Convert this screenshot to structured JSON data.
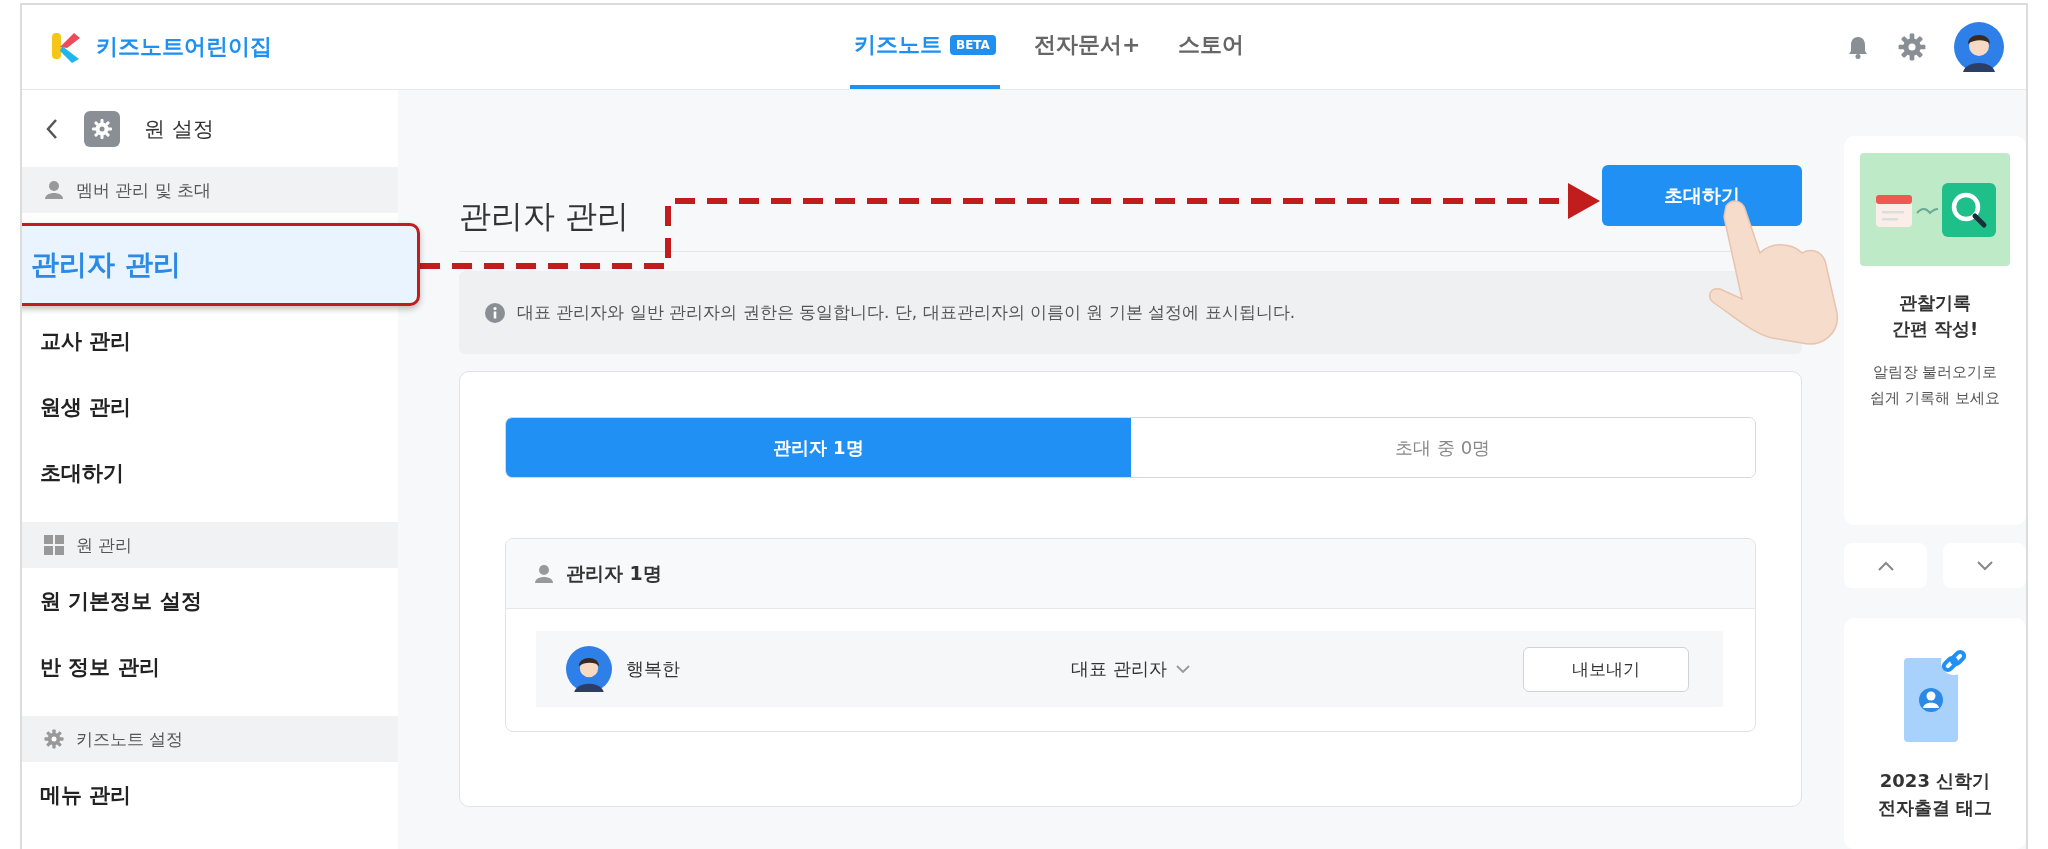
{
  "header": {
    "brand": "키즈노트어린이집",
    "nav": [
      {
        "label": "키즈노트",
        "badge": "BETA",
        "selected": true
      },
      {
        "label": "전자문서+",
        "selected": false
      },
      {
        "label": "스토어",
        "selected": false
      }
    ]
  },
  "sidebar": {
    "title": "원 설정",
    "sections": [
      {
        "kind": "person",
        "title": "멤버 관리 및 초대",
        "items": [
          {
            "label": "관리자 관리",
            "selected": true
          },
          {
            "label": "교사 관리",
            "selected": false
          },
          {
            "label": "원생 관리",
            "selected": false
          },
          {
            "label": "초대하기",
            "selected": false
          }
        ]
      },
      {
        "kind": "grid",
        "title": "원 관리",
        "items": [
          {
            "label": "원 기본정보 설정",
            "selected": false
          },
          {
            "label": "반 정보 관리",
            "selected": false
          }
        ]
      },
      {
        "kind": "gear",
        "title": "키즈노트 설정",
        "items": [
          {
            "label": "메뉴 관리",
            "selected": false
          }
        ]
      }
    ]
  },
  "page": {
    "title": "관리자 관리",
    "action": "초대하기",
    "notice": "대표 관리자와 일반 관리자의 권한은 동일합니다. 단, 대표관리자의 이름이 원 기본 설정에 표시됩니다.",
    "tabs": [
      {
        "label": "관리자 1명",
        "selected": true
      },
      {
        "label": "초대 중 0명",
        "selected": false
      }
    ],
    "list": {
      "title": "관리자 1명",
      "rows": [
        {
          "name": "행복한",
          "role": "대표 관리자",
          "action": "내보내기"
        }
      ]
    }
  },
  "rail": {
    "cards": [
      {
        "kind": "observe",
        "title_lines": [
          "관찰기록",
          "간편 작성!"
        ],
        "desc_lines": [
          "알림장 불러오기로",
          "쉽게 기록해 보세요"
        ]
      },
      {
        "kind": "tag",
        "title_lines": [
          "2023 신학기",
          "전자출결 태그"
        ]
      }
    ]
  }
}
